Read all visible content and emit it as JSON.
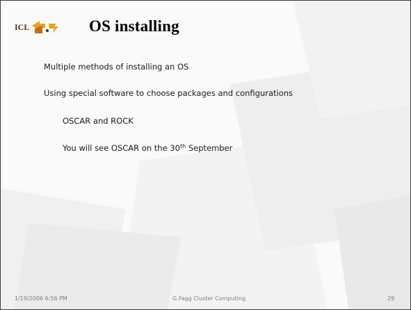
{
  "slide": {
    "logo_icon": "icl-logo-icon",
    "title": "OS installing",
    "bullets": [
      "Multiple methods of installing an OS",
      "Using special software to choose packages and configurations",
      "OSCAR and ROCK"
    ],
    "bullet4": {
      "before": "You will see OSCAR on the 30",
      "sup": "th",
      "after": " September"
    },
    "footer": {
      "date": "1/19/2006 6:56 PM",
      "center": "G.Fagg Cluster Computing",
      "page_number": "29"
    }
  },
  "colors": {
    "background": "#fafafa",
    "border": "#3a3a3a",
    "logo_orange": "#e8a020",
    "logo_dark": "#4a2a10",
    "text": "#1a1a1a",
    "footer_text": "#7a7a7a"
  }
}
